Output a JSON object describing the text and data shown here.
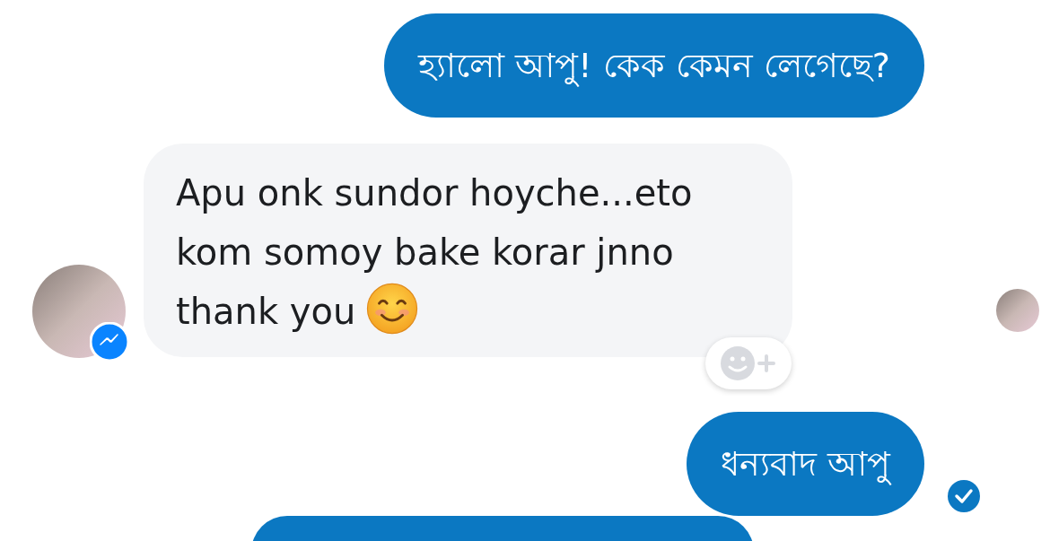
{
  "messages": [
    {
      "kind": "sent",
      "text": "হ্যালো আপু! কেক কেমন লেগেছে?"
    },
    {
      "kind": "received",
      "text": "Apu onk sundor hoyche...eto kom somoy bake korar jnno thank you",
      "reaction_button": true,
      "seen": true
    },
    {
      "kind": "sent",
      "text": "ধন্যবাদ আপু",
      "delivered": true
    },
    {
      "kind": "sent_partial"
    }
  ]
}
